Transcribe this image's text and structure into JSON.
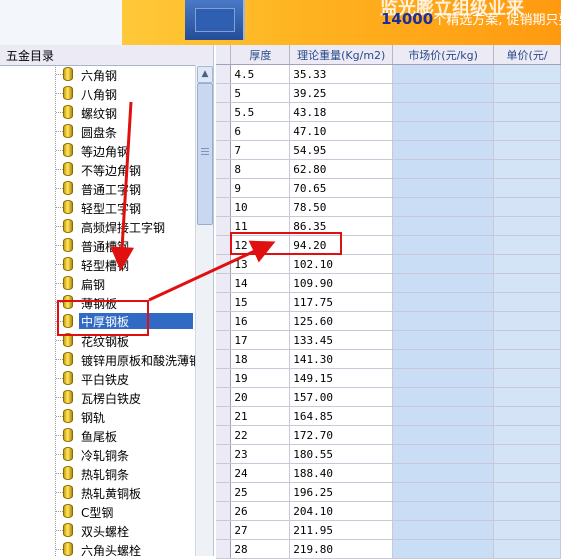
{
  "banner": {
    "top_text": "监光膨立组级业来",
    "number": "14000",
    "text": "个精选方案, 促销期只要"
  },
  "tree": {
    "header": "五金目录",
    "items": [
      {
        "label": "六角钢"
      },
      {
        "label": "八角钢"
      },
      {
        "label": "螺纹钢"
      },
      {
        "label": "圆盘条"
      },
      {
        "label": "等边角钢"
      },
      {
        "label": "不等边角钢"
      },
      {
        "label": "普通工字钢"
      },
      {
        "label": "轻型工字钢"
      },
      {
        "label": "高频焊接工字钢"
      },
      {
        "label": "普通槽钢"
      },
      {
        "label": "轻型槽钢"
      },
      {
        "label": "扁钢"
      },
      {
        "label": "薄钢板"
      },
      {
        "label": "中厚钢板",
        "selected": true
      },
      {
        "label": "花纹钢板"
      },
      {
        "label": "镀锌用原板和酸洗薄钢"
      },
      {
        "label": "平白铁皮"
      },
      {
        "label": "瓦楞白铁皮"
      },
      {
        "label": "钢轨"
      },
      {
        "label": "鱼尾板"
      },
      {
        "label": "冷轧铜条"
      },
      {
        "label": "热轧铜条"
      },
      {
        "label": "热轧黄铜板"
      },
      {
        "label": "C型钢"
      },
      {
        "label": "双头螺栓"
      },
      {
        "label": "六角头螺栓"
      }
    ]
  },
  "grid": {
    "columns": [
      "厚度",
      "理论重量(Kg/m2)",
      "市场价(元/kg)",
      "单价(元/"
    ],
    "rows": [
      [
        "4.5",
        "35.33"
      ],
      [
        "5",
        "39.25"
      ],
      [
        "5.5",
        "43.18"
      ],
      [
        "6",
        "47.10"
      ],
      [
        "7",
        "54.95"
      ],
      [
        "8",
        "62.80"
      ],
      [
        "9",
        "70.65"
      ],
      [
        "10",
        "78.50"
      ],
      [
        "11",
        "86.35"
      ],
      [
        "12",
        "94.20"
      ],
      [
        "13",
        "102.10"
      ],
      [
        "14",
        "109.90"
      ],
      [
        "15",
        "117.75"
      ],
      [
        "16",
        "125.60"
      ],
      [
        "17",
        "133.45"
      ],
      [
        "18",
        "141.30"
      ],
      [
        "19",
        "149.15"
      ],
      [
        "20",
        "157.00"
      ],
      [
        "21",
        "164.85"
      ],
      [
        "22",
        "172.70"
      ],
      [
        "23",
        "180.55"
      ],
      [
        "24",
        "188.40"
      ],
      [
        "25",
        "196.25"
      ],
      [
        "26",
        "204.10"
      ],
      [
        "27",
        "211.95"
      ],
      [
        "28",
        "219.80"
      ]
    ]
  },
  "colors": {
    "selection": "#316ac5",
    "annotation": "#e01010",
    "price_column": "#c9ddf5"
  }
}
